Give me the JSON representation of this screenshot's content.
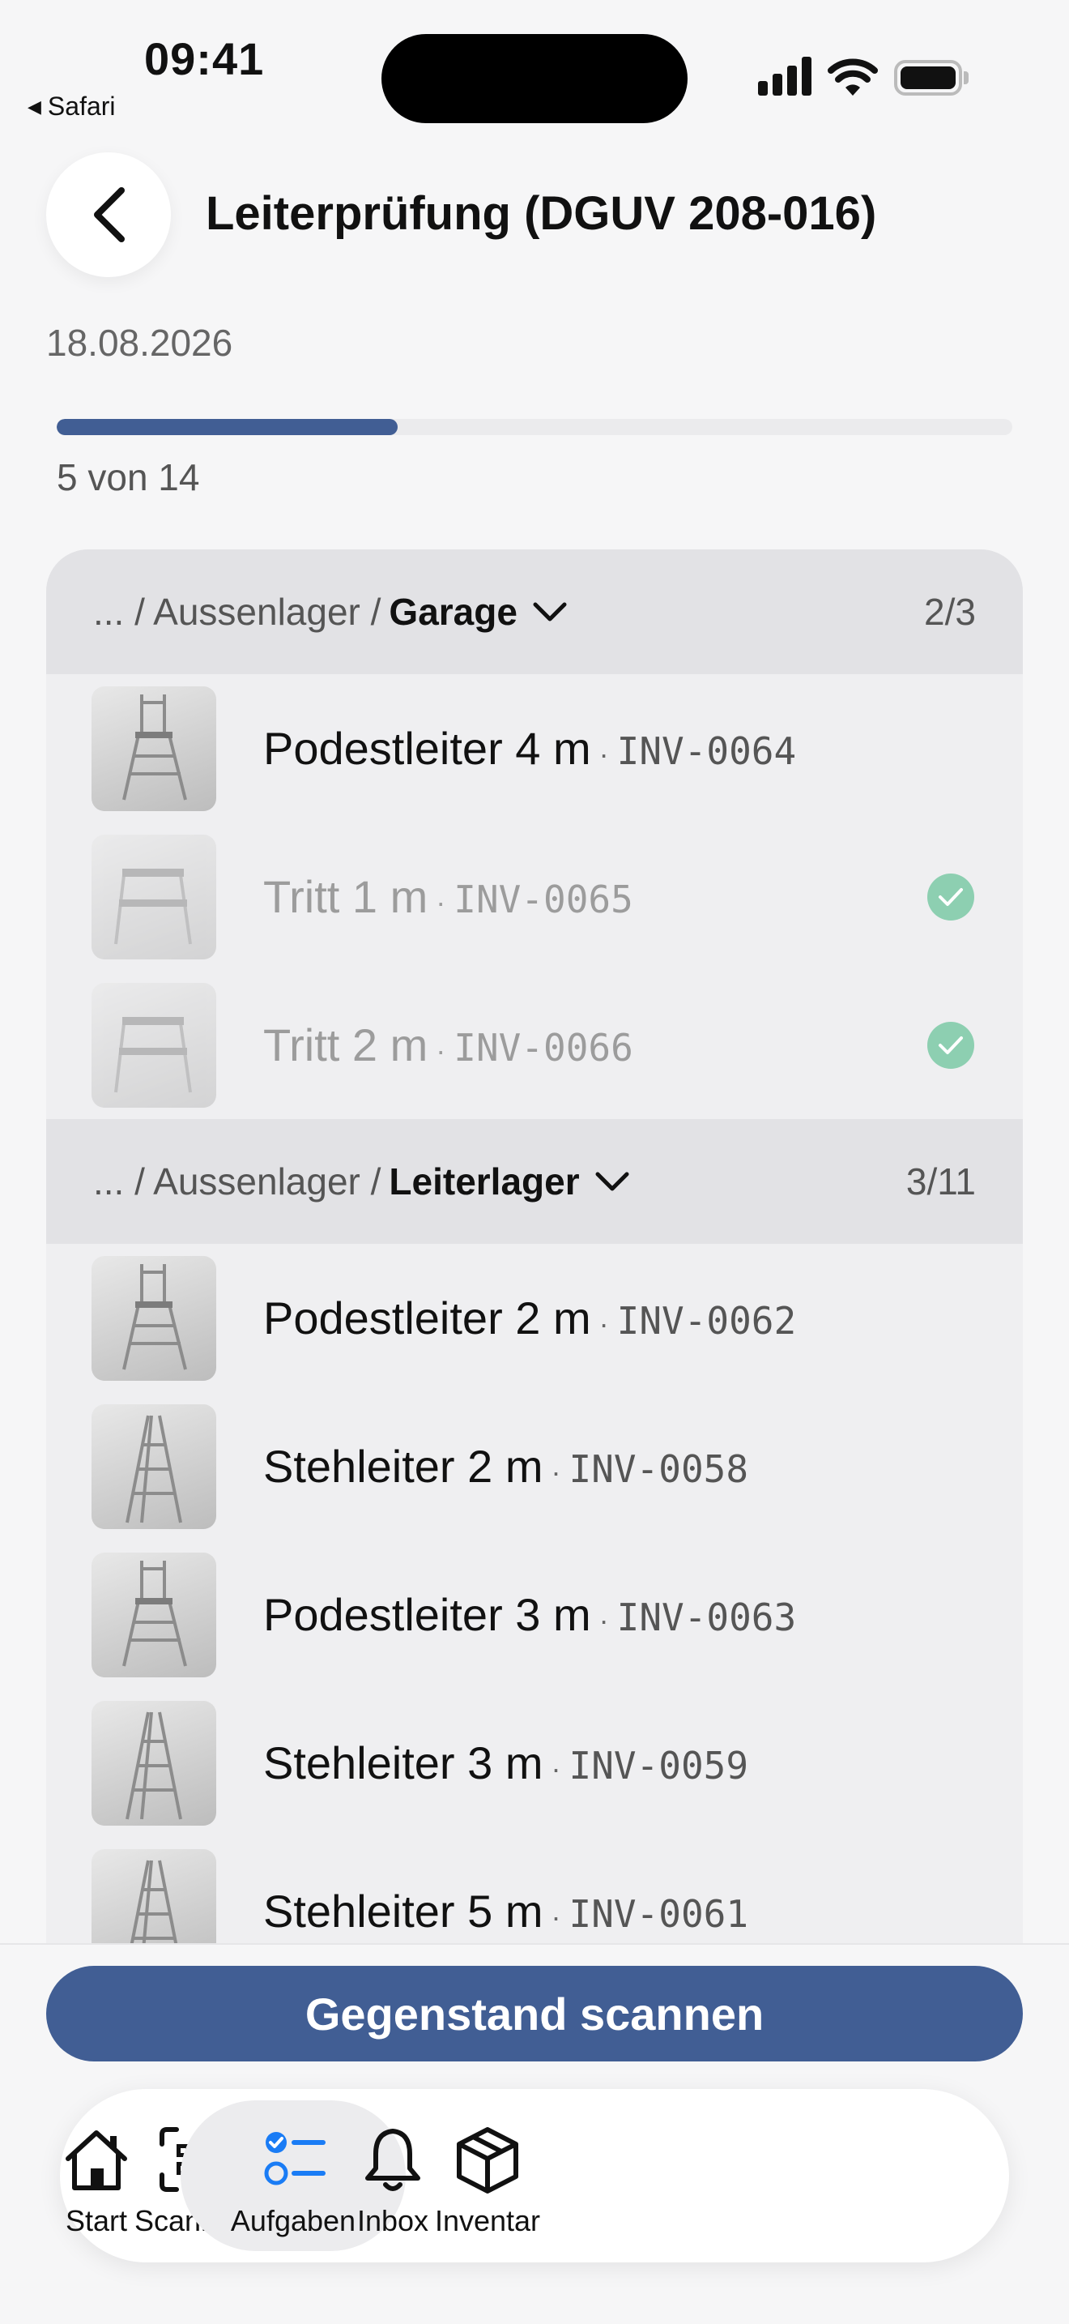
{
  "status_bar": {
    "time": "09:41",
    "back_app": "Safari"
  },
  "header": {
    "title": "Leiterprüfung (DGUV 208-016)"
  },
  "date": "18.08.2026",
  "progress": {
    "done": 5,
    "total": 14,
    "text": "5 von 14"
  },
  "groups": [
    {
      "path_prefix": "... / Aussenlager /",
      "location": "Garage",
      "count": "2/3",
      "items": [
        {
          "name": "Podestleiter 4 m",
          "code": "INV-0064",
          "done": false,
          "type": "podest"
        },
        {
          "name": "Tritt 1 m",
          "code": "INV-0065",
          "done": true,
          "type": "tritt"
        },
        {
          "name": "Tritt 2 m",
          "code": "INV-0066",
          "done": true,
          "type": "tritt"
        }
      ]
    },
    {
      "path_prefix": "... / Aussenlager /",
      "location": "Leiterlager",
      "count": "3/11",
      "items": [
        {
          "name": "Podestleiter 2 m",
          "code": "INV-0062",
          "done": false,
          "type": "podest"
        },
        {
          "name": "Stehleiter 2 m",
          "code": "INV-0058",
          "done": false,
          "type": "steh"
        },
        {
          "name": "Podestleiter 3 m",
          "code": "INV-0063",
          "done": false,
          "type": "podest"
        },
        {
          "name": "Stehleiter 3 m",
          "code": "INV-0059",
          "done": false,
          "type": "steh"
        },
        {
          "name": "Stehleiter 5 m",
          "code": "INV-0061",
          "done": false,
          "type": "steh"
        }
      ]
    }
  ],
  "scan_button": "Gegenstand scannen",
  "tabs": [
    {
      "label": "Start",
      "icon": "house-icon",
      "active": false
    },
    {
      "label": "Scannen",
      "icon": "qr-scan-icon",
      "active": false
    },
    {
      "label": "Aufgaben",
      "icon": "checklist-icon",
      "active": true
    },
    {
      "label": "Inbox",
      "icon": "bell-icon",
      "active": false
    },
    {
      "label": "Inventar",
      "icon": "box-icon",
      "active": false
    }
  ],
  "colors": {
    "accent": "#415e94",
    "check": "#8dcfb1"
  }
}
